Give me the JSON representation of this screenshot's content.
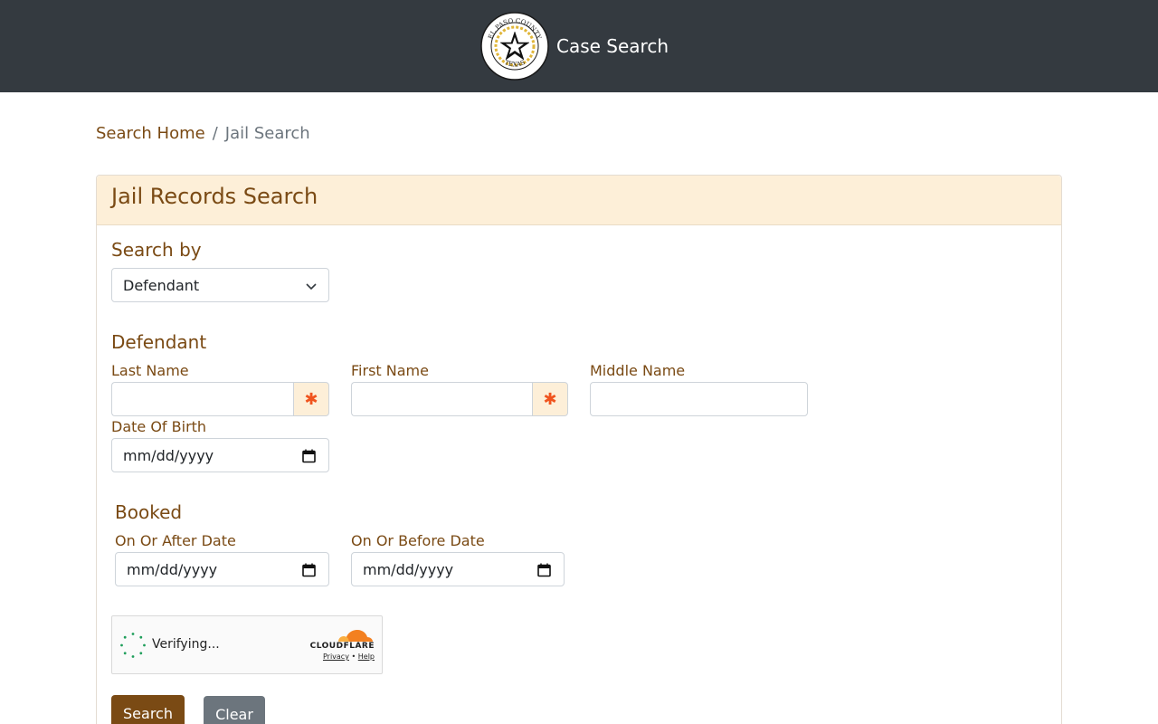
{
  "header": {
    "seal_top_text": "EL PASO COUNTY",
    "seal_bottom_text": "TEXAS",
    "title": "Case Search"
  },
  "breadcrumb": {
    "home": "Search Home",
    "separator": "/",
    "current": "Jail Search"
  },
  "card": {
    "title": "Jail Records Search"
  },
  "search_by": {
    "label": "Search by",
    "selected": "Defendant"
  },
  "defendant": {
    "section_title": "Defendant",
    "last_name_label": "Last Name",
    "first_name_label": "First Name",
    "middle_name_label": "Middle Name",
    "dob_label": "Date Of Birth",
    "dob_placeholder": "mm/dd/yyyy",
    "required_mark": "✱"
  },
  "booked": {
    "section_title": "Booked",
    "after_label": "On Or After Date",
    "after_placeholder": "mm/dd/yyyy",
    "before_label": "On Or Before Date",
    "before_placeholder": "mm/dd/yyyy"
  },
  "captcha": {
    "status": "Verifying...",
    "brand": "CLOUDFLARE",
    "privacy": "Privacy",
    "dot": "•",
    "help": "Help"
  },
  "buttons": {
    "search": "Search",
    "clear": "Clear"
  },
  "colors": {
    "navbar": "#343a40",
    "accent_brown": "#7a4a14",
    "header_bg": "#fdefd8",
    "required": "#f0541e",
    "clear_button": "#6c757d"
  }
}
